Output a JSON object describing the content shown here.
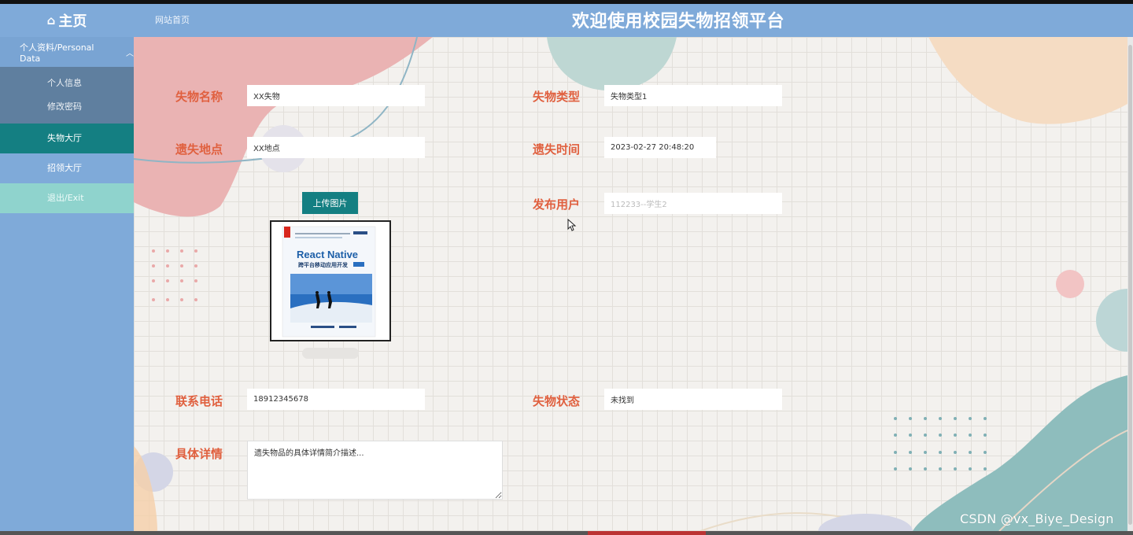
{
  "header": {
    "brand": "主页",
    "nav_link": "网站首页",
    "title": "欢迎使用校园失物招领平台"
  },
  "sidebar": {
    "group_label": "个人资料/Personal Data",
    "sub_items": [
      "个人信息",
      "修改密码"
    ],
    "items": [
      "失物大厅",
      "招领大厅",
      "退出/Exit"
    ]
  },
  "form": {
    "name_label": "失物名称",
    "name_value": "XX失物",
    "type_label": "失物类型",
    "type_value": "失物类型1",
    "place_label": "遗失地点",
    "place_value": "XX地点",
    "time_label": "遗失时间",
    "time_value": "2023-02-27 20:48:20",
    "upload_label": "上传图片",
    "user_label": "发布用户",
    "user_value": "112233--学生2",
    "phone_label": "联系电话",
    "phone_value": "18912345678",
    "status_label": "失物状态",
    "status_value": "未找到",
    "detail_label": "具体详情",
    "detail_value": "遗失物品的具体详情简介描述..."
  },
  "image": {
    "title": "React Native",
    "subtitle": "跨平台移动应用开发"
  },
  "watermark": "CSDN @vx_Biye_Design",
  "colors": {
    "accent": "#147f82",
    "label": "#e0603f",
    "sidebar": "#7faad9",
    "exit": "#8fd3cd"
  }
}
